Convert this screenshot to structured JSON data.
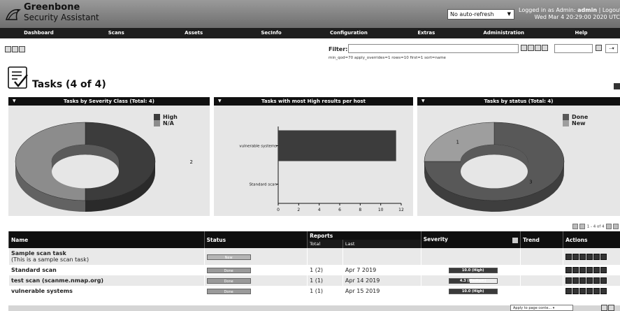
{
  "header": {
    "brand_line1": "Greenbone",
    "brand_line2": "Security Assistant",
    "refresh_value": "No auto-refresh",
    "login_prefix": "Logged in as",
    "login_role": "Admin",
    "login_user": "admin",
    "logout": "Logout",
    "datetime": "Wed Mar 4 20:29:00 2020 UTC"
  },
  "menu": [
    "Dashboard",
    "Scans",
    "Assets",
    "SecInfo",
    "Configuration",
    "Extras",
    "Administration",
    "Help"
  ],
  "filter": {
    "label": "Filter:",
    "value": "",
    "applied": "min_qod=70 apply_overrides=1 rows=10 first=1 sort=name"
  },
  "page": {
    "title": "Tasks (4 of 4)",
    "icon": "tasks-icon"
  },
  "panels": [
    {
      "title": "Tasks by Severity Class (Total: 4)"
    },
    {
      "title": "Tasks with most High results per host"
    },
    {
      "title": "Tasks by status (Total: 4)"
    }
  ],
  "chart_data": [
    {
      "type": "pie",
      "title": "Tasks by Severity Class (Total: 4)",
      "categories": [
        "High",
        "N/A"
      ],
      "values": [
        2,
        2
      ],
      "colors": [
        "#3c3c3c",
        "#8c8c8c"
      ],
      "legend": "top-right"
    },
    {
      "type": "bar",
      "title": "Tasks with most High results per host",
      "orientation": "horizontal",
      "categories": [
        "vulnerable systems",
        "Standard scan"
      ],
      "values": [
        11.5,
        0
      ],
      "xticks": [
        0,
        2,
        4,
        6,
        8,
        10,
        12
      ],
      "xlim": [
        0,
        12
      ],
      "color": "#3c3c3c"
    },
    {
      "type": "pie",
      "title": "Tasks by status (Total: 4)",
      "categories": [
        "Done",
        "New"
      ],
      "values": [
        3,
        1
      ],
      "colors": [
        "#585858",
        "#9e9e9e"
      ],
      "legend": "top-right"
    }
  ],
  "pager": {
    "text": "1 - 4 of 4"
  },
  "table": {
    "headers": {
      "name": "Name",
      "status": "Status",
      "reports": "Reports",
      "total": "Total",
      "last": "Last",
      "severity": "Severity",
      "trend": "Trend",
      "actions": "Actions"
    },
    "rows": [
      {
        "name": "Sample scan task",
        "comment": "(This is a sample scan task)",
        "status": "New",
        "total": "",
        "last": "",
        "severity": "",
        "severity_value": 0
      },
      {
        "name": "Standard scan",
        "comment": "",
        "status": "Done",
        "total": "1 (2)",
        "last": "Apr 7 2019",
        "severity": "10.0 (High)",
        "severity_value": 1.0
      },
      {
        "name": "test scan (scanme.nmap.org)",
        "comment": "",
        "status": "Done",
        "total": "1 (1)",
        "last": "Apr 14 2019",
        "severity": "4.3 (Medium)",
        "severity_value": 0.43
      },
      {
        "name": "vulnerable systems",
        "comment": "",
        "status": "Done",
        "total": "1 (1)",
        "last": "Apr 15 2019",
        "severity": "10.0 (High)",
        "severity_value": 1.0
      }
    ]
  },
  "bottom": {
    "select": "Apply to page conte..."
  }
}
